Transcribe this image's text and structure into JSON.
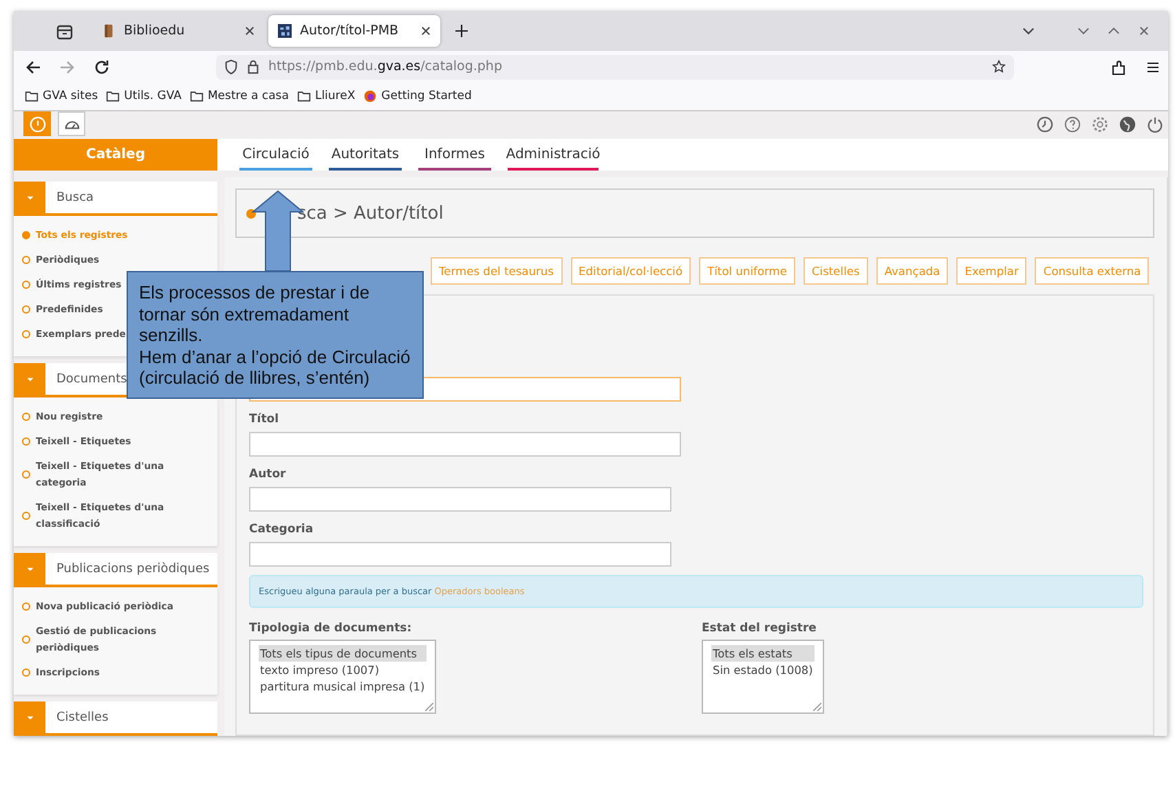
{
  "browser": {
    "tabs": [
      {
        "title": "Biblioedu",
        "selected": false
      },
      {
        "title": "Autor/títol-PMB",
        "selected": true
      }
    ],
    "url": {
      "prefix": "https://pmb.edu.",
      "domain": "gva.es",
      "path": "/catalog.php"
    },
    "bookmarks": [
      {
        "label": "GVA sites",
        "kind": "folder"
      },
      {
        "label": "Utils. GVA",
        "kind": "folder"
      },
      {
        "label": "Mestre a casa",
        "kind": "folder"
      },
      {
        "label": "LliureX",
        "kind": "folder"
      },
      {
        "label": "Getting Started",
        "kind": "firefox"
      }
    ]
  },
  "app": {
    "brand": "Catàleg",
    "menu": [
      {
        "label": "Circulació",
        "color": "#4aa0e0"
      },
      {
        "label": "Autoritats",
        "color": "#2f5d9a"
      },
      {
        "label": "Informes",
        "color": "#a5407e"
      },
      {
        "label": "Administració",
        "color": "#e0185a"
      }
    ],
    "sidebar": [
      {
        "title": "Busca",
        "items": [
          {
            "label": "Tots els registres",
            "selected": true
          },
          {
            "label": "Periòdiques",
            "selected": false
          },
          {
            "label": "Últims registres",
            "selected": false
          },
          {
            "label": "Predefinides",
            "selected": false
          },
          {
            "label": "Exemplars prede",
            "selected": false
          }
        ]
      },
      {
        "title": "Documents",
        "items": [
          {
            "label": "Nou registre",
            "selected": false
          },
          {
            "label": "Teixell - Etiquetes",
            "selected": false
          },
          {
            "label": "Teixell - Etiquetes d'una categoria",
            "selected": false
          },
          {
            "label": "Teixell - Etiquetes d'una classificació",
            "selected": false
          }
        ]
      },
      {
        "title": "Publicacions periòdiques",
        "items": [
          {
            "label": "Nova publicació periòdica",
            "selected": false
          },
          {
            "label": "Gestió de publicacions periòdiques",
            "selected": false
          },
          {
            "label": "Inscripcions",
            "selected": false
          }
        ]
      },
      {
        "title": "Cistelles"
      }
    ],
    "breadcrumb": "sca > Autor/títol",
    "search_tabs": [
      "Termes del tesaurus",
      "Editorial/col·lecció",
      "Títol uniforme",
      "Cistelles",
      "Avançada",
      "Exemplar",
      "Consulta externa"
    ],
    "fields": [
      {
        "focused": true
      },
      {
        "label": "Títol",
        "focused": false
      },
      {
        "label": "Autor",
        "focused": false
      },
      {
        "label": "Categoria",
        "focused": false
      }
    ],
    "hint": {
      "text": "Escrigueu alguna paraula per a buscar",
      "link": "Operadors booleans"
    },
    "lists": [
      {
        "label": "Tipologia de documents:",
        "options": [
          {
            "text": "Tots els tipus de documents",
            "selected": true
          },
          {
            "text": "texto impreso (1007)",
            "selected": false
          },
          {
            "text": "partitura musical impresa (1)",
            "selected": false
          }
        ]
      },
      {
        "label": "Estat del registre",
        "options": [
          {
            "text": "Tots els estats",
            "selected": true
          },
          {
            "text": "Sin estado (1008)",
            "selected": false
          }
        ]
      }
    ]
  },
  "callout": {
    "paragraphs": [
      "Els processos de prestar i de tornar són extremadament senzills.",
      "Hem d’anar a l’opció de Circulació (circulació de llibres, s’entén)"
    ]
  }
}
